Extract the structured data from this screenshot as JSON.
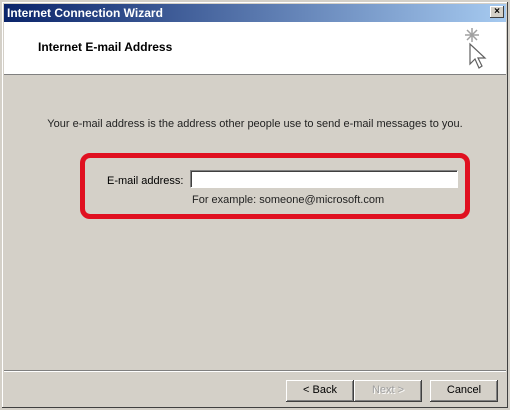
{
  "window": {
    "title": "Internet Connection Wizard",
    "close_glyph": "×"
  },
  "header": {
    "heading": "Internet E-mail Address",
    "icon": "wizard-cursor-sparkle-icon"
  },
  "main": {
    "description": "Your e-mail address is the address other people use to send e-mail messages to you.",
    "email_label": "E-mail address:",
    "email_value": "",
    "example": "For example: someone@microsoft.com",
    "highlight_color": "#e01020"
  },
  "footer": {
    "back_label": "< Back",
    "next_label": "Next >",
    "cancel_label": "Cancel"
  }
}
